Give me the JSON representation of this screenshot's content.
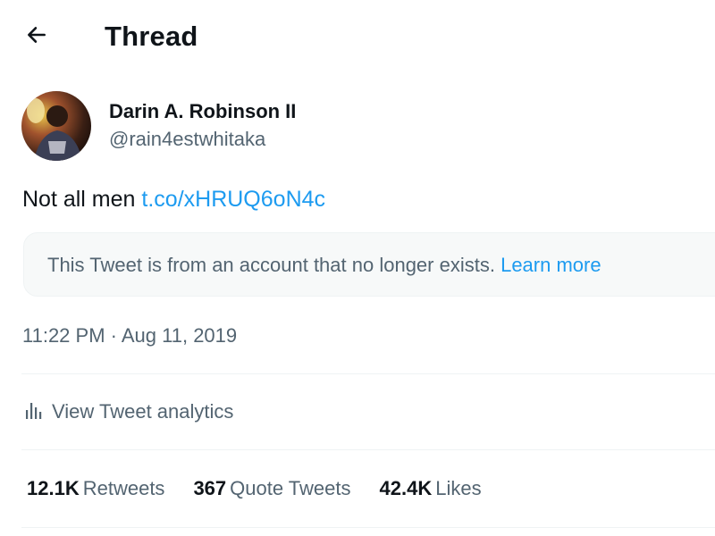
{
  "header": {
    "back_icon": "arrow-left-icon",
    "title": "Thread"
  },
  "tweet": {
    "author": {
      "display_name": "Darin A. Robinson II",
      "handle": "@rain4estwhitaka"
    },
    "text": "Not all men",
    "link": "t.co/xHRUQ6oN4c",
    "quoted_notice": {
      "text": "This Tweet is from an account that no longer exists.",
      "learn_more": "Learn more"
    },
    "timestamp": "11:22 PM · Aug 11, 2019",
    "analytics": {
      "icon": "analytics-bars-icon",
      "label": "View Tweet analytics"
    },
    "stats": {
      "retweets": {
        "count": "12.1K",
        "label": "Retweets"
      },
      "quotes": {
        "count": "367",
        "label": "Quote Tweets"
      },
      "likes": {
        "count": "42.4K",
        "label": "Likes"
      }
    }
  },
  "colors": {
    "link": "#1d9bf0",
    "secondary_text": "#536471",
    "primary_text": "#0f1419",
    "notice_background": "#f7f9f9",
    "divider": "#eff3f4"
  }
}
